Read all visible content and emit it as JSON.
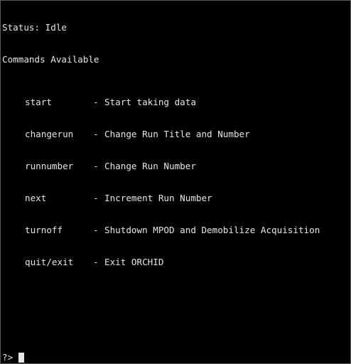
{
  "status": {
    "label": "Status: Idle"
  },
  "commands": {
    "heading": "Commands Available",
    "separator": "-",
    "items": [
      {
        "name": "start",
        "description": "Start taking data"
      },
      {
        "name": "changerun",
        "description": "Change Run Title and Number"
      },
      {
        "name": "runnumber",
        "description": "Change Run Number"
      },
      {
        "name": "next",
        "description": "Increment Run Number"
      },
      {
        "name": "turnoff",
        "description": "Shutdown MPOD and Demobilize Acquisition"
      },
      {
        "name": "quit/exit",
        "description": "Exit ORCHID"
      }
    ]
  },
  "prompt": {
    "symbol": "?> ",
    "input_value": ""
  },
  "colors": {
    "background": "#000000",
    "foreground": "#e6e6e6",
    "border": "#5a5a5a"
  }
}
